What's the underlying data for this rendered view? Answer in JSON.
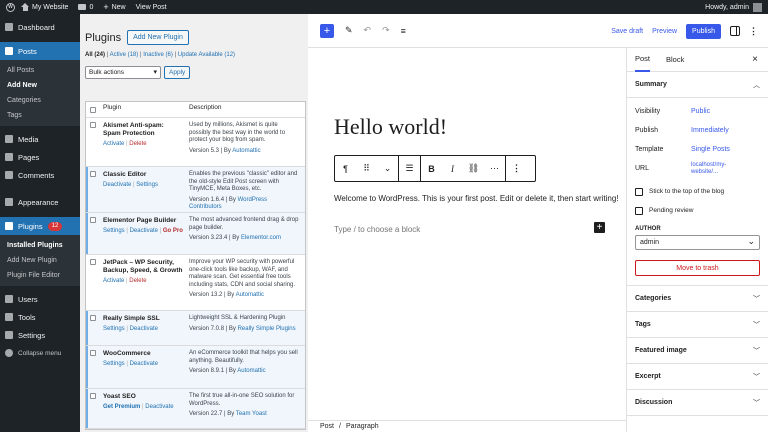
{
  "adminbar": {
    "site_name": "My Website",
    "comments_count": "0",
    "new_label": "New",
    "view_post_label": "View Post",
    "greeting": "Howdy, admin"
  },
  "menu": {
    "dashboard": "Dashboard",
    "posts": "Posts",
    "posts_sub": [
      "All Posts",
      "Add New",
      "Categories",
      "Tags"
    ],
    "media": "Media",
    "pages": "Pages",
    "comments": "Comments",
    "appearance": "Appearance",
    "plugins": "Plugins",
    "plugins_badge": "12",
    "plugins_sub": [
      "Installed Plugins",
      "Add New Plugin",
      "Plugin File Editor"
    ],
    "users": "Users",
    "tools": "Tools",
    "settings": "Settings",
    "collapse": "Collapse menu"
  },
  "plugins_page": {
    "title": "Plugins",
    "add_new": "Add New Plugin",
    "filter_all": "All (24)",
    "filter_active": "Active (18)",
    "filter_inactive": "Inactive (6)",
    "filter_update": "Update Available (12)",
    "sep": "|",
    "bulk_actions": "Bulk actions",
    "apply": "Apply",
    "col_plugin": "Plugin",
    "col_description": "Description",
    "rows": [
      {
        "name": "Akismet Anti-spam: Spam Protection",
        "a1": "Activate",
        "a2": "Delete",
        "desc": "Used by millions, Akismet is quite possibly the best way in the world to protect your blog from spam.",
        "version": "Version 5.3 | By",
        "author": "Automattic",
        "active": false
      },
      {
        "name": "Classic Editor",
        "a1": "Deactivate",
        "a2": "Settings",
        "desc": "Enables the previous \"classic\" editor and the old-style Edit Post screen with TinyMCE, Meta Boxes, etc.",
        "version": "Version 1.6.4 | By",
        "author": "WordPress Contributors",
        "active": true
      },
      {
        "name": "Elementor Page Builder",
        "a1": "Settings",
        "a2": "Deactivate",
        "a3": "Go Pro",
        "desc": "The most advanced frontend drag & drop page builder.",
        "version": "Version 3.23.4 | By",
        "author": "Elementor.com",
        "active": true
      },
      {
        "name": "JetPack – WP Security, Backup, Speed, & Growth",
        "a1": "Activate",
        "a2": "Delete",
        "desc": "Improve your WP security with powerful one-click tools like backup, WAF, and malware scan. Get essential free tools including stats, CDN and social sharing.",
        "version": "Version 13.2 | By",
        "author": "Automattic",
        "active": false
      },
      {
        "name": "Really Simple SSL",
        "a1": "Settings",
        "a2": "Deactivate",
        "desc": "Lightweight SSL & Hardening Plugin",
        "version": "Version 7.0.8 | By",
        "author": "Really Simple Plugins",
        "active": true
      },
      {
        "name": "WooCommerce",
        "a1": "Settings",
        "a2": "Deactivate",
        "desc": "An eCommerce toolkit that helps you sell anything. Beautifully.",
        "version": "Version 8.9.1 | By",
        "author": "Automattic",
        "active": true
      },
      {
        "name": "Yoast SEO",
        "a1": "Get Premium",
        "a2": "Deactivate",
        "desc": "The first true all-in-one SEO solution for WordPress.",
        "version": "Version 22.7 | By",
        "author": "Team Yoast",
        "active": true
      }
    ]
  },
  "editor": {
    "save_draft": "Save draft",
    "preview": "Preview",
    "publish": "Publish",
    "post_title": "Hello world!",
    "paragraph": "Welcome to WordPress. This is your first post. Edit or delete it, then start writing!",
    "placeholder": "Type / to choose a block",
    "breadcrumb_post": "Post",
    "breadcrumb_sep": "/",
    "breadcrumb_block": "Paragraph"
  },
  "sidebar": {
    "tab_post": "Post",
    "tab_block": "Block",
    "summary": "Summary",
    "visibility_label": "Visibility",
    "visibility_value": "Public",
    "publish_label": "Publish",
    "publish_value": "Immediately",
    "template_label": "Template",
    "template_value": "Single Posts",
    "url_label": "URL",
    "url_value": "localhost/my-website/...",
    "sticky": "Stick to the top of the blog",
    "pending": "Pending review",
    "author_label": "AUTHOR",
    "author_value": "admin",
    "trash": "Move to trash",
    "panels": [
      "Categories",
      "Tags",
      "Featured image",
      "Excerpt",
      "Discussion"
    ]
  }
}
